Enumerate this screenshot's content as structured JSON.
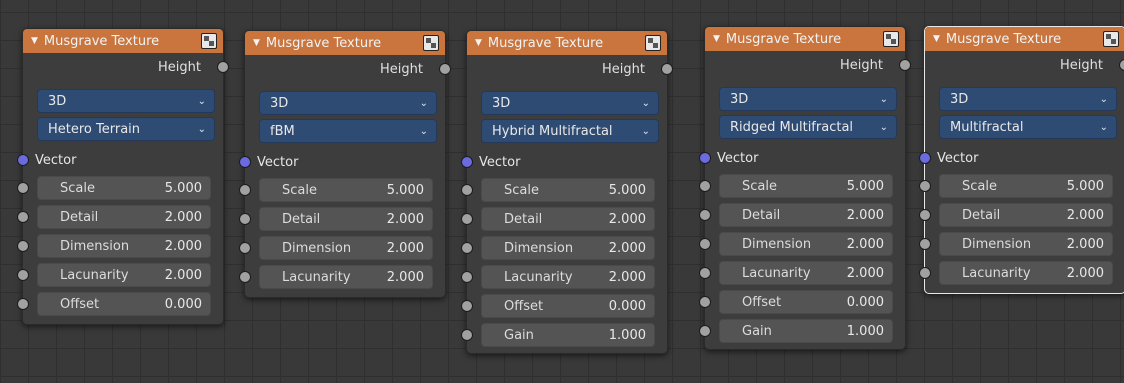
{
  "nodes": [
    {
      "title": "Musgrave Texture",
      "output": "Height",
      "dimensions": "3D",
      "type": "Hetero Terrain",
      "vector_label": "Vector",
      "fields": [
        {
          "label": "Scale",
          "value": "5.000"
        },
        {
          "label": "Detail",
          "value": "2.000"
        },
        {
          "label": "Dimension",
          "value": "2.000"
        },
        {
          "label": "Lacunarity",
          "value": "2.000"
        },
        {
          "label": "Offset",
          "value": "0.000"
        }
      ]
    },
    {
      "title": "Musgrave Texture",
      "output": "Height",
      "dimensions": "3D",
      "type": "fBM",
      "vector_label": "Vector",
      "fields": [
        {
          "label": "Scale",
          "value": "5.000"
        },
        {
          "label": "Detail",
          "value": "2.000"
        },
        {
          "label": "Dimension",
          "value": "2.000"
        },
        {
          "label": "Lacunarity",
          "value": "2.000"
        }
      ]
    },
    {
      "title": "Musgrave Texture",
      "output": "Height",
      "dimensions": "3D",
      "type": "Hybrid Multifractal",
      "vector_label": "Vector",
      "fields": [
        {
          "label": "Scale",
          "value": "5.000"
        },
        {
          "label": "Detail",
          "value": "2.000"
        },
        {
          "label": "Dimension",
          "value": "2.000"
        },
        {
          "label": "Lacunarity",
          "value": "2.000"
        },
        {
          "label": "Offset",
          "value": "0.000"
        },
        {
          "label": "Gain",
          "value": "1.000"
        }
      ]
    },
    {
      "title": "Musgrave Texture",
      "output": "Height",
      "dimensions": "3D",
      "type": "Ridged Multifractal",
      "vector_label": "Vector",
      "fields": [
        {
          "label": "Scale",
          "value": "5.000"
        },
        {
          "label": "Detail",
          "value": "2.000"
        },
        {
          "label": "Dimension",
          "value": "2.000"
        },
        {
          "label": "Lacunarity",
          "value": "2.000"
        },
        {
          "label": "Offset",
          "value": "0.000"
        },
        {
          "label": "Gain",
          "value": "1.000"
        }
      ]
    },
    {
      "title": "Musgrave Texture",
      "output": "Height",
      "dimensions": "3D",
      "type": "Multifractal",
      "vector_label": "Vector",
      "fields": [
        {
          "label": "Scale",
          "value": "5.000"
        },
        {
          "label": "Detail",
          "value": "2.000"
        },
        {
          "label": "Dimension",
          "value": "2.000"
        },
        {
          "label": "Lacunarity",
          "value": "2.000"
        }
      ]
    }
  ],
  "colors": {
    "header": "#c9753d",
    "select": "#2e4b73",
    "field": "#545454",
    "vector_socket": "#6b6be0",
    "value_socket": "#a1a1a1"
  }
}
